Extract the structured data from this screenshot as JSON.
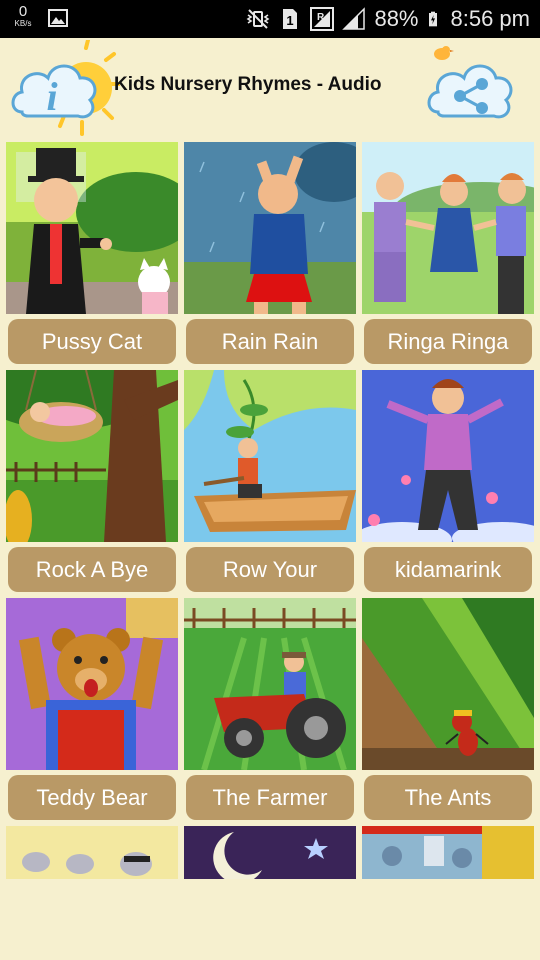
{
  "status_bar": {
    "net_speed_value": "0",
    "net_speed_unit": "KB/s",
    "sim_slot": "1",
    "battery": "88%",
    "time": "8:56 pm"
  },
  "header": {
    "title": "Kids Nursery Rhymes - Audio",
    "info_icon": "info-icon",
    "share_icon": "share-icon"
  },
  "rhymes": [
    {
      "label": "Pussy Cat"
    },
    {
      "label": "Rain Rain"
    },
    {
      "label": "Ringa Ringa"
    },
    {
      "label": "Rock A Bye"
    },
    {
      "label": "Row Your"
    },
    {
      "label": "kidamarink"
    },
    {
      "label": "Teddy Bear"
    },
    {
      "label": "The Farmer"
    },
    {
      "label": "The Ants"
    }
  ],
  "colors": {
    "background": "#f6f0cf",
    "button": "#b99966",
    "button_text": "#ffffff",
    "status_bar": "#000000"
  }
}
